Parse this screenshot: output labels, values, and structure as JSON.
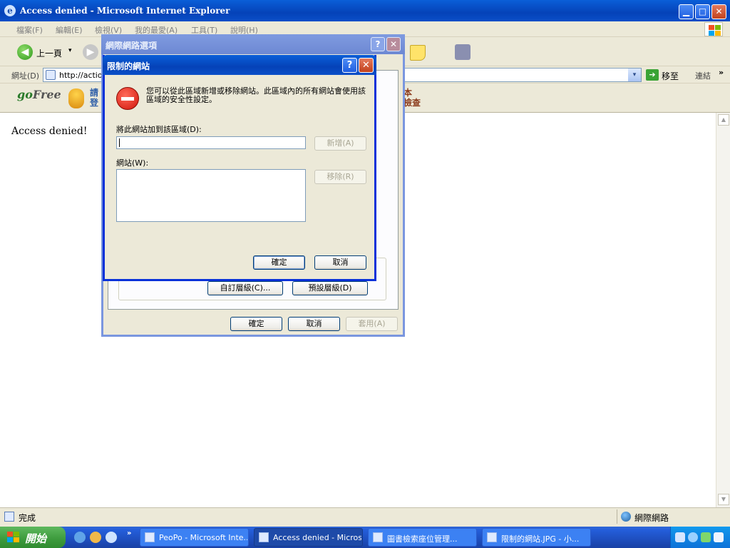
{
  "window": {
    "title": "Access denied - Microsoft Internet Explorer",
    "ie_icon_glyph": "e",
    "min_glyph": "▁",
    "max_glyph": "□",
    "close_glyph": "✕"
  },
  "menu": {
    "items": [
      "檔案(F)",
      "編輯(E)",
      "檢視(V)",
      "我的最愛(A)",
      "工具(T)",
      "說明(H)"
    ]
  },
  "toolbar": {
    "back_label": "上一頁",
    "back_glyph": "◀",
    "dropdown_glyph": "▾",
    "forward_glyph": "▶"
  },
  "address": {
    "label": "網址(D)",
    "url": "http://action1",
    "go_label": "移至",
    "go_glyph": "➔",
    "links_label": "連結",
    "chevron": "»"
  },
  "links_toolbar": {
    "gofree_go": "go",
    "gofree_free": "Free",
    "login_line1": "請",
    "login_line2": "登",
    "book_line1": "本",
    "book_line2": "檢查"
  },
  "content": {
    "message": "Access denied!"
  },
  "scrollbar": {
    "up_glyph": "▲",
    "down_glyph": "▼"
  },
  "status": {
    "left": "完成",
    "zone": "網際網路"
  },
  "internet_options": {
    "title": "網際網路選項",
    "help_glyph": "?",
    "close_glyph": "✕",
    "custom_level": "自訂層級(C)...",
    "default_level": "預設層級(D)",
    "ok": "確定",
    "cancel": "取消",
    "apply": "套用(A)"
  },
  "restricted_dialog": {
    "title": "限制的網站",
    "help_glyph": "?",
    "close_glyph": "✕",
    "description": "您可以從此區域新增或移除網站。此區域內的所有網站會使用該區域的安全性設定。",
    "add_label": "將此網站加到該區域(D):",
    "add_value": "",
    "add_button": "新增(A)",
    "sites_label": "網站(W):",
    "remove_button": "移除(R)",
    "ok": "確定",
    "cancel": "取消"
  },
  "taskbar": {
    "start": "開始",
    "chevron": "»",
    "tasks": [
      {
        "label": "PeoPo - Microsoft Inte..."
      },
      {
        "label": "Access denied - Micros..."
      },
      {
        "label": "圖書檢索座位管理..."
      },
      {
        "label": "限制的網站.JPG - 小..."
      }
    ]
  },
  "colors": {
    "xp_blue": "#0a5fd8",
    "start_green": "#3c9a3c",
    "stop_red": "#d1160b"
  }
}
